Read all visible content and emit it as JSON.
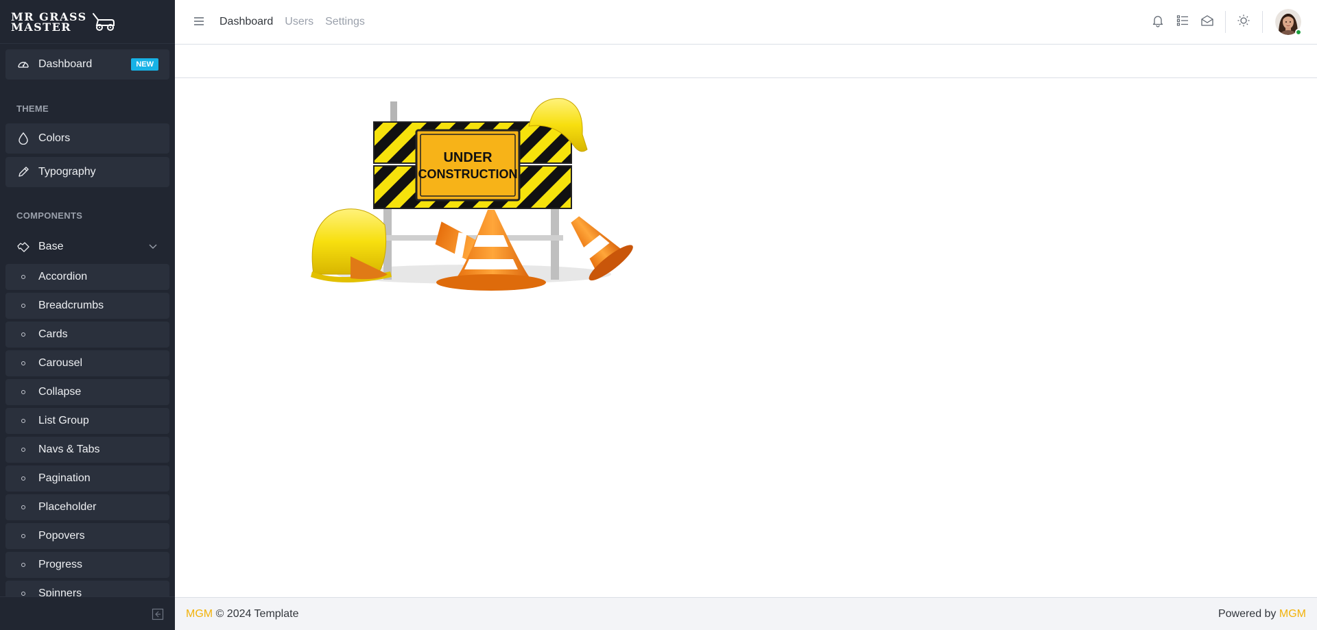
{
  "brand": {
    "line1": "MR GRASS",
    "line2": "MASTER",
    "icon": "lawnmower-icon"
  },
  "sidebar": {
    "dashboard": {
      "label": "Dashboard",
      "badge": "NEW",
      "icon": "speedometer-icon"
    },
    "section_theme": "THEME",
    "theme_items": [
      {
        "label": "Colors",
        "icon": "drop-icon"
      },
      {
        "label": "Typography",
        "icon": "pencil-icon"
      }
    ],
    "section_components": "COMPONENTS",
    "base": {
      "label": "Base",
      "icon": "puzzle-icon",
      "chevron": "chevron-down-icon"
    },
    "base_items": [
      "Accordion",
      "Breadcrumbs",
      "Cards",
      "Carousel",
      "Collapse",
      "List Group",
      "Navs & Tabs",
      "Pagination",
      "Placeholder",
      "Popovers",
      "Progress",
      "Spinners"
    ]
  },
  "header": {
    "nav": [
      "Dashboard",
      "Users",
      "Settings"
    ],
    "icons": [
      "hamburger-icon",
      "bell-icon",
      "list-icon",
      "envelope-icon",
      "sun-icon"
    ]
  },
  "content": {
    "sign_line1": "UNDER",
    "sign_line2": "CONSTRUCTION"
  },
  "footer": {
    "left_brand": "MGM",
    "left_text": "© 2024 Template",
    "right_text": "Powered by",
    "right_brand": "MGM"
  },
  "colors": {
    "sidebar_bg": "#212631",
    "accent": "#f2b20a",
    "badge": "#17b2e6",
    "status_online": "#1b9e3e"
  }
}
